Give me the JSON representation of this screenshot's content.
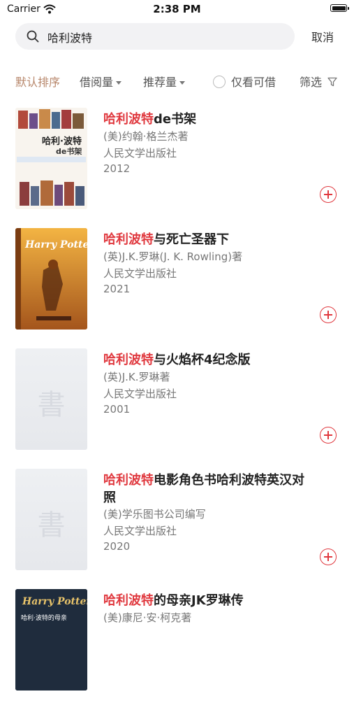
{
  "status": {
    "carrier": "Carrier",
    "time": "2:38 PM"
  },
  "search": {
    "query": "哈利波特",
    "cancel_label": "取消"
  },
  "filters": {
    "default_sort": "默认排序",
    "borrow_count": "借阅量",
    "recommend_count": "推荐量",
    "available_only": "仅看可借",
    "filter": "筛选"
  },
  "placeholder_glyph": "書",
  "books": [
    {
      "highlight": "哈利波特",
      "title_rest": "de书架",
      "author": "(美)约翰·格兰杰著",
      "publisher": "人民文学出版社",
      "year": "2012",
      "cover_title": "哈利·波特",
      "cover_sub": "de书架"
    },
    {
      "highlight": "哈利波特",
      "title_rest": "与死亡圣器下",
      "author": "(英)J.K.罗琳(J. K. Rowling)著",
      "publisher": "人民文学出版社",
      "year": "2021",
      "cover_title": "Harry Potter"
    },
    {
      "highlight": "哈利波特",
      "title_rest": "与火焰杯4纪念版",
      "author": "(英)J.K.罗琳著",
      "publisher": "人民文学出版社",
      "year": "2001"
    },
    {
      "highlight": "哈利波特",
      "title_rest": "电影角色书哈利波特英汉对照",
      "author": "(美)学乐图书公司编写",
      "publisher": "人民文学出版社",
      "year": "2020"
    },
    {
      "highlight": "哈利波特",
      "title_rest": "的母亲JK罗琳传",
      "author": "(美)康尼·安·柯克著",
      "cover_title": "Harry Potter",
      "cover_sub": "哈利·波特的母亲"
    }
  ]
}
